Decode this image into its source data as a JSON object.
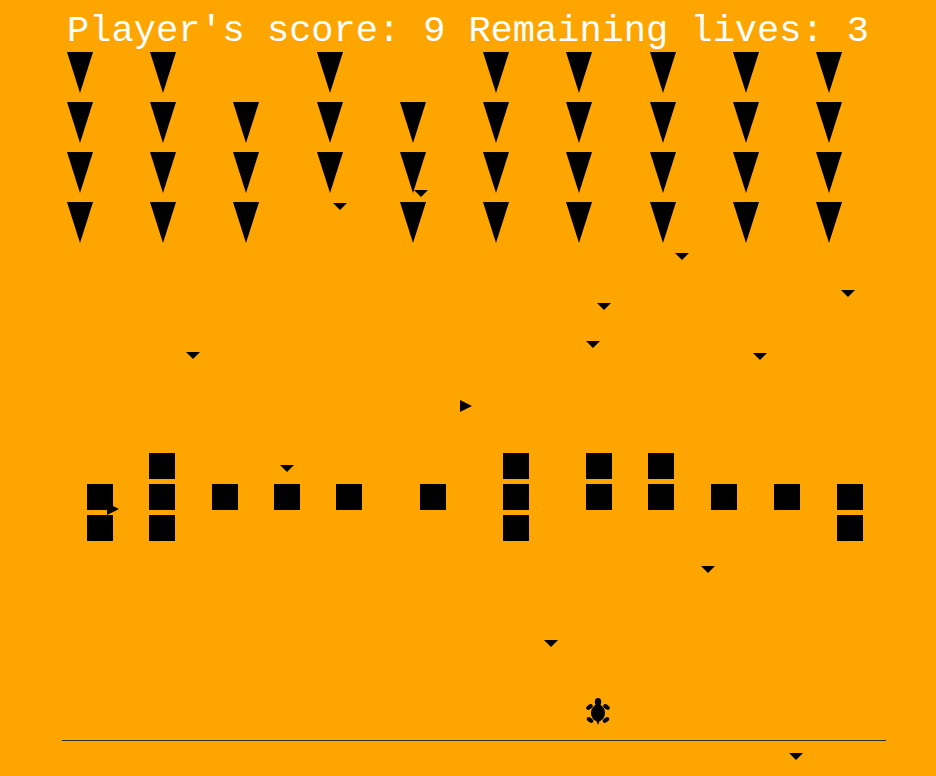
{
  "hud": {
    "score_label": "Player's score:",
    "score": "9",
    "lives_label": "Remaining lives:",
    "lives": "3"
  },
  "aliens": [
    [
      {
        "alive": true
      },
      {
        "alive": true
      },
      {
        "alive": false
      },
      {
        "alive": true
      },
      {
        "alive": false
      },
      {
        "alive": true
      },
      {
        "alive": true
      },
      {
        "alive": true
      },
      {
        "alive": true
      },
      {
        "alive": true
      }
    ],
    [
      {
        "alive": true
      },
      {
        "alive": true
      },
      {
        "alive": true
      },
      {
        "alive": true
      },
      {
        "alive": true
      },
      {
        "alive": true
      },
      {
        "alive": true
      },
      {
        "alive": true
      },
      {
        "alive": true
      },
      {
        "alive": true
      }
    ],
    [
      {
        "alive": true
      },
      {
        "alive": true
      },
      {
        "alive": true
      },
      {
        "alive": true
      },
      {
        "alive": true
      },
      {
        "alive": true
      },
      {
        "alive": true
      },
      {
        "alive": true
      },
      {
        "alive": true
      },
      {
        "alive": true
      }
    ],
    [
      {
        "alive": true
      },
      {
        "alive": true
      },
      {
        "alive": true
      },
      {
        "alive": false
      },
      {
        "alive": true
      },
      {
        "alive": true
      },
      {
        "alive": true
      },
      {
        "alive": true
      },
      {
        "alive": true
      },
      {
        "alive": true
      }
    ]
  ],
  "shields": [
    {
      "blocks": [
        false,
        true,
        true
      ]
    },
    {
      "blocks": [
        true,
        true,
        true
      ]
    },
    {
      "blocks": [
        false,
        true,
        false
      ]
    },
    {
      "blocks": [
        false,
        true,
        false
      ]
    },
    {
      "blocks": [
        false,
        true,
        false
      ]
    },
    {
      "blocks": [
        false,
        true,
        false
      ]
    },
    {
      "blocks": [
        true,
        true,
        true
      ]
    },
    {
      "blocks": [
        true,
        true,
        false
      ]
    },
    {
      "blocks": [
        true,
        true,
        false
      ]
    },
    {
      "blocks": [
        false,
        true,
        false
      ]
    },
    {
      "blocks": [
        false,
        true,
        false
      ]
    },
    {
      "blocks": [
        false,
        true,
        true
      ]
    }
  ],
  "bullets": [
    {
      "kind": "down"
    },
    {
      "kind": "down"
    },
    {
      "kind": "down"
    },
    {
      "kind": "down"
    },
    {
      "kind": "down"
    },
    {
      "kind": "down"
    },
    {
      "kind": "down"
    },
    {
      "kind": "down"
    },
    {
      "kind": "down"
    },
    {
      "kind": "down"
    },
    {
      "kind": "down"
    },
    {
      "kind": "down"
    },
    {
      "kind": "right"
    },
    {
      "kind": "right"
    }
  ],
  "player": {
    "alive": true
  }
}
